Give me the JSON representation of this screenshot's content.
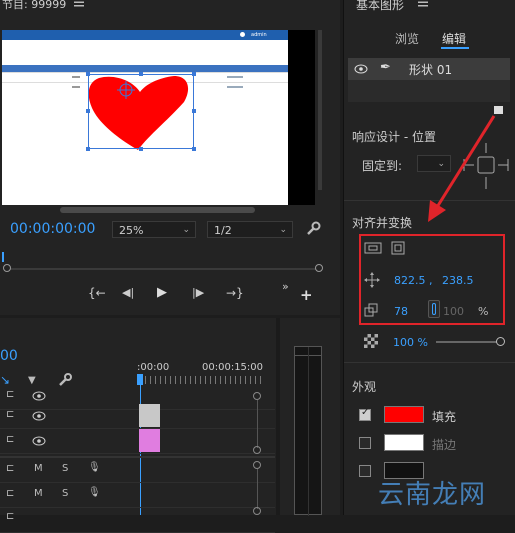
{
  "program": {
    "title": "节目: 99999",
    "menu_icon": "hamburger-icon",
    "timecode": "00:00:00:00",
    "zoom": "25%",
    "resolution": "1/2"
  },
  "preview": {
    "header_user": "admin",
    "table_headers": [
      "",
      "",
      "",
      ""
    ],
    "shape_color": "#ff0000"
  },
  "timeline": {
    "timecode_partial": "00",
    "ruler_start": ":00:00",
    "ruler_mid": "00:00:15:00",
    "track_labels": [
      "M",
      "S"
    ],
    "clip_colors": [
      "#c8c8c8",
      "#e07de0"
    ]
  },
  "essential_graphics": {
    "title": "基本图形",
    "tabs": [
      "浏览",
      "编辑"
    ],
    "active_tab": "编辑",
    "layer_name": "形状 01",
    "responsive_design_label": "响应设计 - 位置",
    "pin_to_label": "固定到:",
    "align_transform_label": "对齐并变换",
    "position_x": "822.5 ,",
    "position_y": "238.5",
    "scale_value": "78",
    "scale_value2": "100",
    "percent": "%",
    "opacity": "100 %",
    "appearance_label": "外观",
    "fill_label": "填充",
    "stroke_label": "描边",
    "fill_color": "#ff0000",
    "stroke_color": "#ffffff",
    "accent_red": "#e0242a"
  },
  "watermark": {
    "text": "云南龙网"
  }
}
